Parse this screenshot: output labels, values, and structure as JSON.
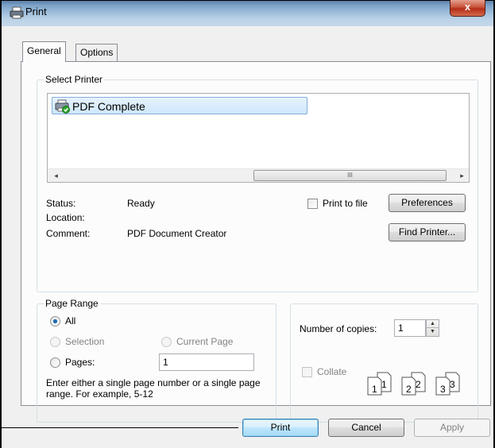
{
  "window": {
    "title": "Print",
    "close_glyph": "x",
    "colors": {
      "default_button_border": "#3c7fb1",
      "selection": "#cfe7fb",
      "radio_dot": "#1d6ab2"
    }
  },
  "tabs": [
    {
      "label": "General",
      "active": true
    },
    {
      "label": "Options",
      "active": false
    }
  ],
  "select_printer": {
    "group_label": "Select Printer",
    "printers": [
      {
        "name": "PDF Complete",
        "icon": "printer-check-icon",
        "selected": true
      }
    ],
    "scrollbar": {
      "left_arrow": "◂",
      "right_arrow": "▸",
      "thumb_grip": "III"
    },
    "status_label": "Status:",
    "status_value": "Ready",
    "location_label": "Location:",
    "location_value": "",
    "comment_label": "Comment:",
    "comment_value": "PDF Document Creator",
    "print_to_file_label": "Print to file",
    "print_to_file_checked": false,
    "preferences_label": "Preferences",
    "find_printer_label": "Find Printer..."
  },
  "page_range": {
    "group_label": "Page Range",
    "all_label": "All",
    "selection_label": "Selection",
    "current_page_label": "Current Page",
    "pages_label": "Pages:",
    "pages_value": "1",
    "selected": "All",
    "hint": "Enter either a single page number or a single page range.  For example, 5-12"
  },
  "copies": {
    "number_label": "Number of copies:",
    "number_value": "1",
    "spin_up": "▲",
    "spin_down": "▼",
    "collate_label": "Collate",
    "collate_checked": false,
    "collate_pages": [
      {
        "back": "1",
        "front": "1"
      },
      {
        "back": "2",
        "front": "2"
      },
      {
        "back": "3",
        "front": "3"
      }
    ]
  },
  "buttons": {
    "print": "Print",
    "cancel": "Cancel",
    "apply": "Apply"
  }
}
